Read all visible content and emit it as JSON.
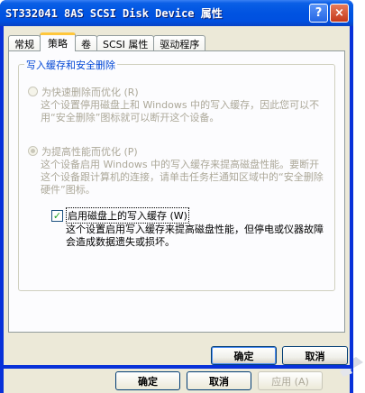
{
  "window": {
    "title": "ST332041 8AS SCSI Disk Device 属性"
  },
  "titlebar_buttons": {
    "help": "?",
    "close": "×"
  },
  "tabs": [
    {
      "label": "常规"
    },
    {
      "label": "策略"
    },
    {
      "label": "卷"
    },
    {
      "label": "SCSI 属性"
    },
    {
      "label": "驱动程序"
    }
  ],
  "active_tab": "策略",
  "group": {
    "title": "写入缓存和安全删除",
    "option_quick": {
      "label": "为快速删除而优化 (R)",
      "description": "这个设置停用磁盘上和 Windows 中的写入缓存，因此您可以不用“安全删除”图标就可以断开这个设备。"
    },
    "option_perf": {
      "label": "为提高性能而优化 (P)",
      "description": "这个设备启用 Windows 中的写入缓存来提高磁盘性能。要断开这个设备跟计算机的连接，请单击任务栏通知区域中的“安全删除硬件”图标。"
    },
    "write_cache": {
      "label": "启用磁盘上的写入缓存 (W)",
      "checked": true,
      "description": "这个设置启用写入缓存来提高磁盘性能，但停电或仪器故障会造成数据遗失或损坏。"
    }
  },
  "buttons": {
    "ok": "确定",
    "cancel": "取消"
  },
  "back_dialog": {
    "ok": "确定",
    "cancel": "取消",
    "apply": "应用 (A)"
  },
  "colors": {
    "title_blue": "#0053e1",
    "frame_blue": "#0831d9",
    "close_red": "#c5391a",
    "tab_highlight": "#ffc73c",
    "group_title": "#0046d5",
    "check_green": "#21a121",
    "face": "#ece9d8"
  }
}
